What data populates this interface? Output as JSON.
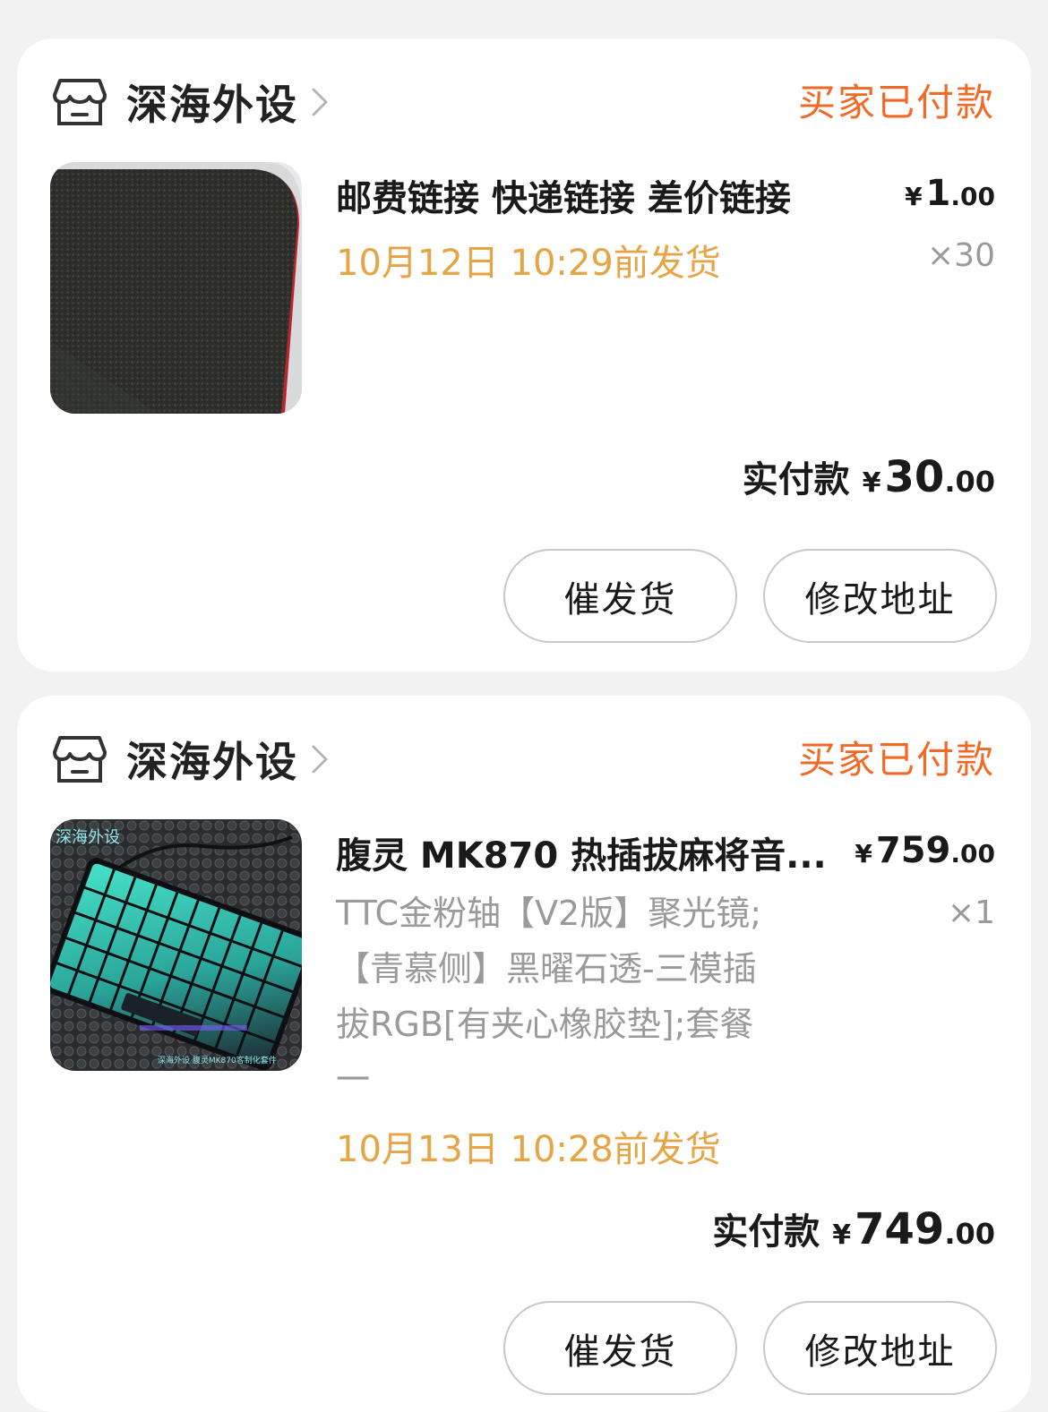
{
  "orders": [
    {
      "shop_name": "深海外设",
      "status": "买家已付款",
      "product": {
        "title": "邮费链接 快递链接 差价链接",
        "price_currency": "¥",
        "price_int": "1",
        "price_dec": ".00",
        "quantity": "×30",
        "ship_by": "10月12日 10:29前发货",
        "image": "black-mousepad-photo"
      },
      "paid_label": "实付款",
      "paid_currency": "¥",
      "paid_int": "30",
      "paid_dec": ".00",
      "buttons": {
        "urge": "催发货",
        "modify_address": "修改地址"
      }
    },
    {
      "shop_name": "深海外设",
      "status": "买家已付款",
      "product": {
        "title": "腹灵 MK870 热插拔麻将音...",
        "price_currency": "¥",
        "price_int": "759",
        "price_dec": ".00",
        "quantity": "×1",
        "spec_lines": [
          "TTC金粉轴【V2版】聚光镜;",
          "【青慕侧】黑曜石透-三模插",
          "拔RGB[有夹心橡胶垫];套餐",
          "一"
        ],
        "ship_by": "10月13日 10:28前发货",
        "image": "cyan-keyboard-photo",
        "image_watermark_top": "深海外设",
        "image_watermark_bottom": "深海外设 腹灵MK870客制化套件"
      },
      "paid_label": "实付款",
      "paid_currency": "¥",
      "paid_int": "749",
      "paid_dec": ".00",
      "buttons": {
        "urge": "催发货",
        "modify_address": "修改地址"
      }
    }
  ],
  "colors": {
    "status_orange": "#f06a26",
    "ship_gold": "#e6a445",
    "background": "#f2f2f2"
  },
  "icons": [
    "store-icon",
    "chevron-right-icon"
  ]
}
